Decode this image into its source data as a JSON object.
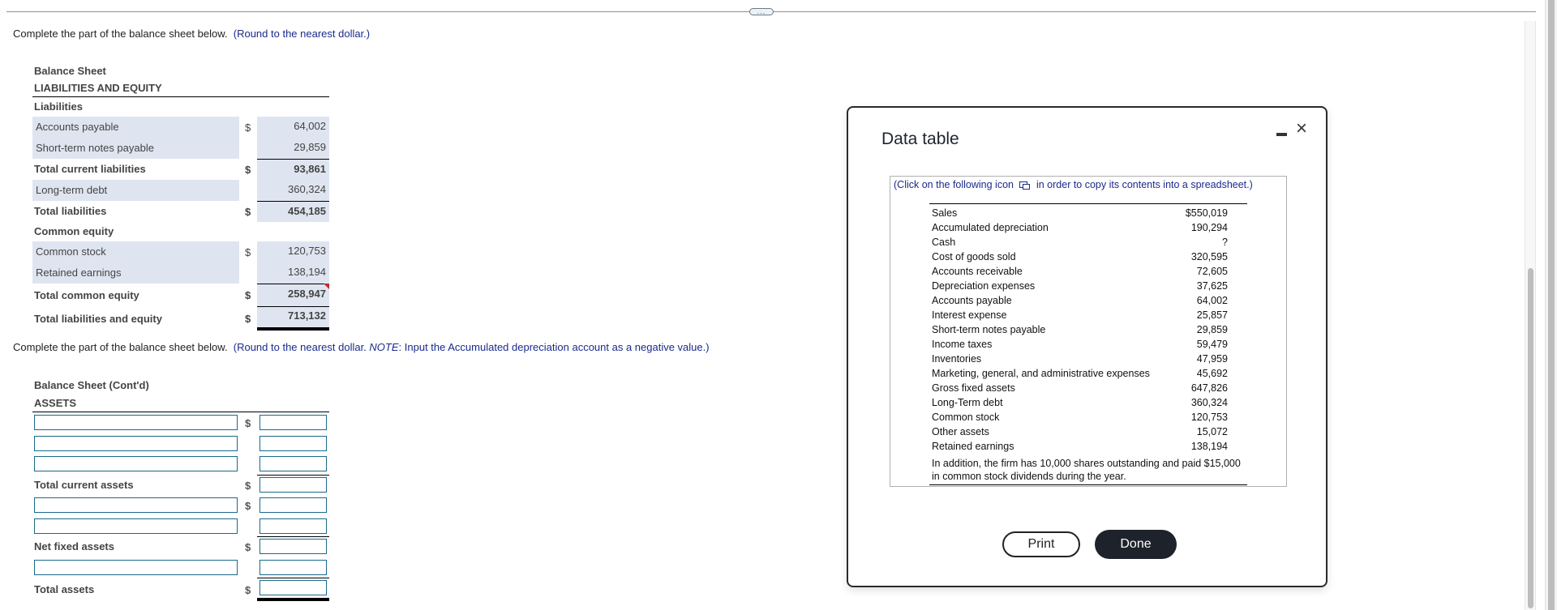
{
  "expand_button": "...",
  "part1": {
    "instruction": "Complete the part of the balance sheet below.",
    "hint": "(Round to the nearest dollar.)",
    "title": "Balance Sheet",
    "section": "LIABILITIES AND EQUITY",
    "rows": [
      {
        "label": "Liabilities",
        "type": "heading"
      },
      {
        "label": "Accounts payable",
        "dollar": "$",
        "value": "64,002"
      },
      {
        "label": "Short-term notes payable",
        "value": "29,859"
      },
      {
        "label": "Total current liabilities",
        "dollar": "$",
        "value": "93,861"
      },
      {
        "label": "Long-term debt",
        "value": "360,324"
      },
      {
        "label": "Total liabilities",
        "dollar": "$",
        "value": "454,185"
      },
      {
        "label": "Common equity",
        "type": "heading"
      },
      {
        "label": "Common stock",
        "dollar": "$",
        "value": "120,753"
      },
      {
        "label": "Retained earnings",
        "value": "138,194"
      },
      {
        "label": "Total common equity",
        "dollar": "$",
        "value": "258,947"
      },
      {
        "label": "Total liabilities and equity",
        "dollar": "$",
        "value": "713,132"
      }
    ]
  },
  "part2": {
    "instruction": "Complete the part of the balance sheet below.",
    "hint_pre": "(Round to the nearest dollar. ",
    "hint_note": "NOTE",
    "hint_post": ": Input the Accumulated depreciation  account as a negative value.)",
    "title": "Balance Sheet (Cont'd)",
    "section": "ASSETS",
    "dollar": "$",
    "labels": {
      "total_current_assets": "Total current assets",
      "net_fixed_assets": "Net fixed assets",
      "total_assets": "Total assets"
    },
    "inputs": {
      "line1_label": "",
      "line1_value": "",
      "line2_label": "",
      "line2_value": "",
      "line3_label": "",
      "line3_value": "",
      "total_current_assets_value": "",
      "line4_label": "",
      "line4_value": "",
      "line5_label": "",
      "line5_value": "",
      "net_fixed_assets_value": "",
      "line6_label": "",
      "line6_value": "",
      "total_assets_value": ""
    }
  },
  "dialog": {
    "title": "Data table",
    "minimize_icon": "minimize-icon",
    "close_label": "×",
    "note_pre": "(Click on the following icon",
    "note_post": "in order to copy its contents into a spreadsheet.)",
    "rows": [
      {
        "label": "Sales",
        "value": "$550,019"
      },
      {
        "label": "Accumulated depreciation",
        "value": "190,294"
      },
      {
        "label": "Cash",
        "value": "?"
      },
      {
        "label": "Cost of goods sold",
        "value": "320,595"
      },
      {
        "label": "Accounts receivable",
        "value": "72,605"
      },
      {
        "label": "Depreciation expenses",
        "value": "37,625"
      },
      {
        "label": "Accounts payable",
        "value": "64,002"
      },
      {
        "label": "Interest expense",
        "value": "25,857"
      },
      {
        "label": "Short-term notes payable",
        "value": "29,859"
      },
      {
        "label": "Income taxes",
        "value": "59,479"
      },
      {
        "label": "Inventories",
        "value": "47,959"
      },
      {
        "label": "Marketing, general, and administrative expenses",
        "value": "45,692"
      },
      {
        "label": "Gross fixed assets",
        "value": "647,826"
      },
      {
        "label": "Long-Term debt",
        "value": "360,324"
      },
      {
        "label": "Common stock",
        "value": "120,753"
      },
      {
        "label": "Other assets",
        "value": "15,072"
      },
      {
        "label": "Retained earnings",
        "value": "138,194"
      }
    ],
    "footnote": "In addition, the firm has 10,000 shares outstanding and paid $15,000 in common stock dividends during the year.",
    "print_label": "Print",
    "done_label": "Done"
  }
}
